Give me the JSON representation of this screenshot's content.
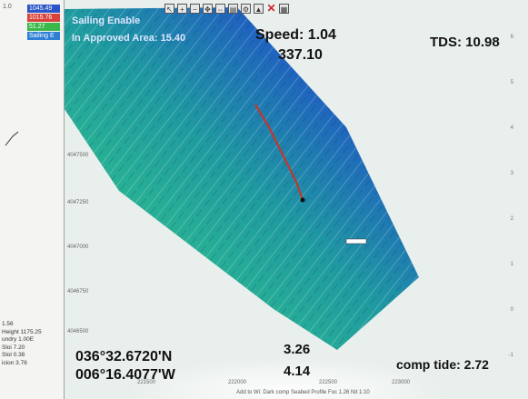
{
  "overlay": {
    "sailing_label": "Sailing Enable",
    "approval_label": "In Approved Area: 15.40",
    "speed": "Speed: 1.04",
    "heading": "337.10",
    "tds": "TDS: 10.98",
    "latitude": "036°32.6720'N",
    "longitude": "006°16.4077'W",
    "depth_a": "3.26",
    "depth_b": "4.14",
    "comp_tide": "comp tide: 2.72"
  },
  "legend": [
    {
      "label": "1045.49",
      "color": "#2a55c8"
    },
    {
      "label": "1015.76",
      "color": "#d8423a"
    },
    {
      "label": "51.27",
      "color": "#3bb84a"
    },
    {
      "label": "Sailing E",
      "color": "#2f7fd6"
    }
  ],
  "left_stats": [
    "1.56",
    "Height 1175.25",
    "undry 1.00E",
    "Sloi 7.20",
    "Slol 0.38",
    "icion 3.76"
  ],
  "map_labels": {
    "y_ticks": [
      "4047500",
      "4047250",
      "4047000",
      "4046750",
      "4046500"
    ],
    "x_ticks": [
      "221500",
      "222000",
      "222500",
      "223000"
    ],
    "right_scale": [
      "6",
      "5",
      "4",
      "3",
      "2",
      "1",
      "0",
      "-1"
    ],
    "status": "Add to Wi: Dark comp Seabed Profile   Foc   1.26   Nit 1:10"
  },
  "colors": {
    "deep": "#1b3fa8",
    "mid": "#1f9ba0",
    "shallow": "#b7d94a",
    "track": "#c0392b"
  }
}
